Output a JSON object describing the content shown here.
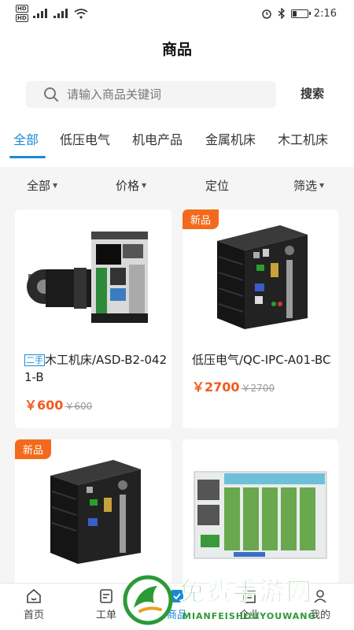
{
  "status_bar": {
    "hd1": "HD",
    "hd2": "HD",
    "sig1": "4G",
    "sig2": "4G",
    "time": "2:16",
    "battery_level": 0.25
  },
  "header": {
    "title": "商品"
  },
  "search": {
    "placeholder": "请输入商品关键词",
    "button_label": "搜索"
  },
  "tabs": [
    {
      "label": "全部",
      "active": true
    },
    {
      "label": "低压电气"
    },
    {
      "label": "机电产品"
    },
    {
      "label": "金属机床"
    },
    {
      "label": "木工机床"
    }
  ],
  "filters": [
    {
      "label": "全部"
    },
    {
      "label": "价格"
    },
    {
      "label": "定位"
    },
    {
      "label": "筛选"
    }
  ],
  "products": [
    {
      "tag": "二手",
      "title": "木工机床/ASD-B2-0421-B",
      "price": "￥600",
      "old_price": "￥600"
    },
    {
      "badge": "新品",
      "title": "低压电气/QC-IPC-A01-BC",
      "price": "￥2700",
      "old_price": "￥2700"
    },
    {
      "badge": "新品"
    },
    {}
  ],
  "bottom_nav": [
    {
      "label": "首页",
      "icon": "home-icon"
    },
    {
      "label": "工单",
      "icon": "order-icon"
    },
    {
      "label": "商品",
      "icon": "goods-icon",
      "active": true
    },
    {
      "label": "企业",
      "icon": "company-icon"
    },
    {
      "label": "我的",
      "icon": "profile-icon"
    }
  ],
  "watermark": {
    "title": "免费手游网",
    "subtitle": "MIANFEISHOUYOUWANG"
  },
  "colors": {
    "accent": "#1a8ad6",
    "price": "#f25a1e",
    "badge": "#f46a1c",
    "watermark": "#2b9a37"
  }
}
